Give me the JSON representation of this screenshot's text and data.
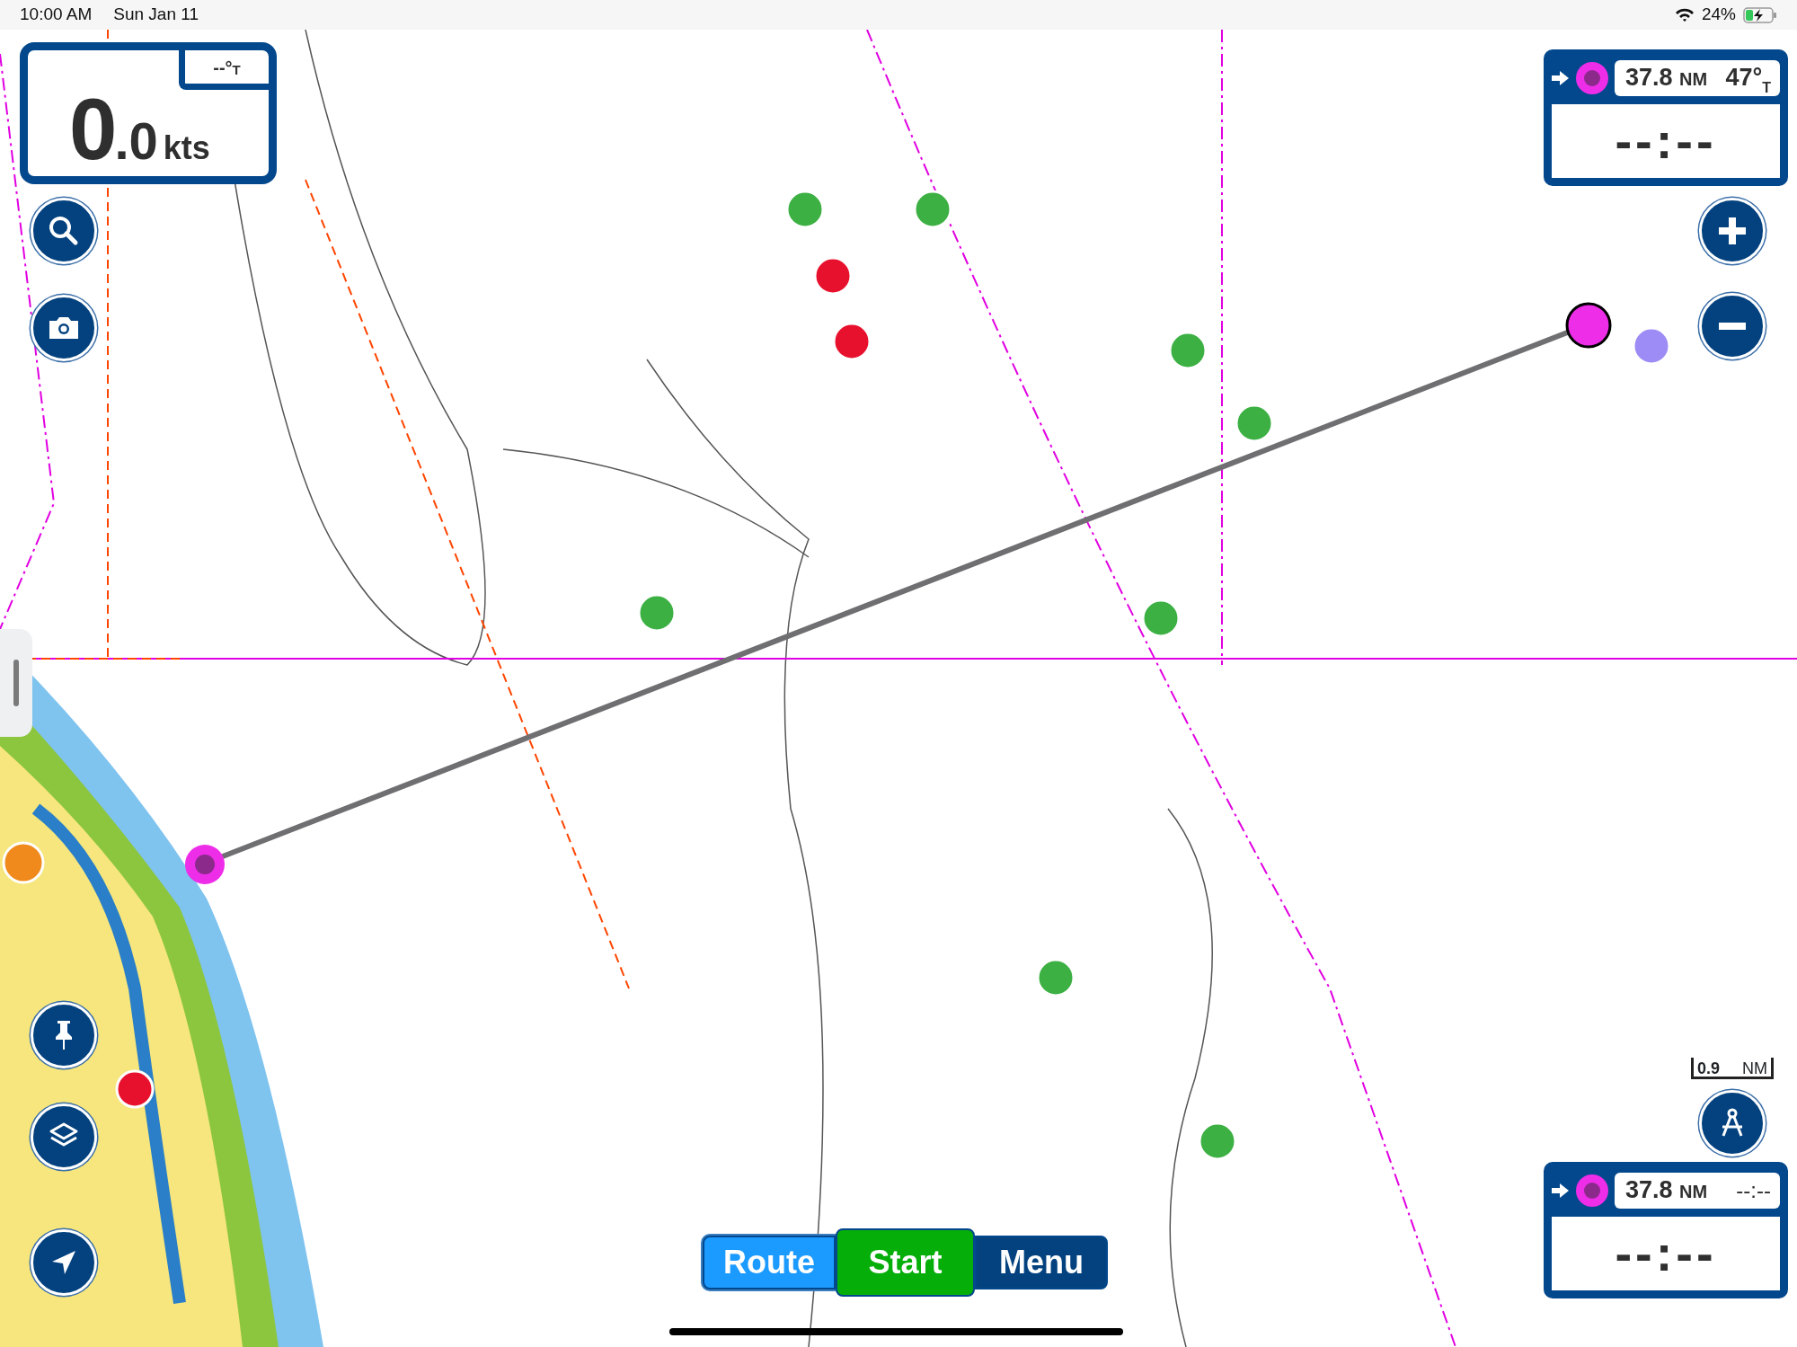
{
  "status_bar": {
    "time": "10:00 AM",
    "date": "Sun Jan 11",
    "battery": "24%"
  },
  "speed_panel": {
    "whole": "0",
    "decimal": ".0",
    "unit": "kts",
    "heading": "--°",
    "heading_ref": "T"
  },
  "destination_panel": {
    "distance": "37.8",
    "distance_unit": "NM",
    "bearing": "47°",
    "bearing_ref": "T",
    "readout": "--:--"
  },
  "route_panel": {
    "distance": "37.8",
    "distance_unit": "NM",
    "time": "--:--",
    "readout": "--:--"
  },
  "scale": {
    "value": "0.9",
    "unit": "NM"
  },
  "bottom_buttons": [
    {
      "label": "Route",
      "kind": "route"
    },
    {
      "label": "Start",
      "kind": "start"
    },
    {
      "label": "Menu",
      "kind": "menu"
    }
  ]
}
